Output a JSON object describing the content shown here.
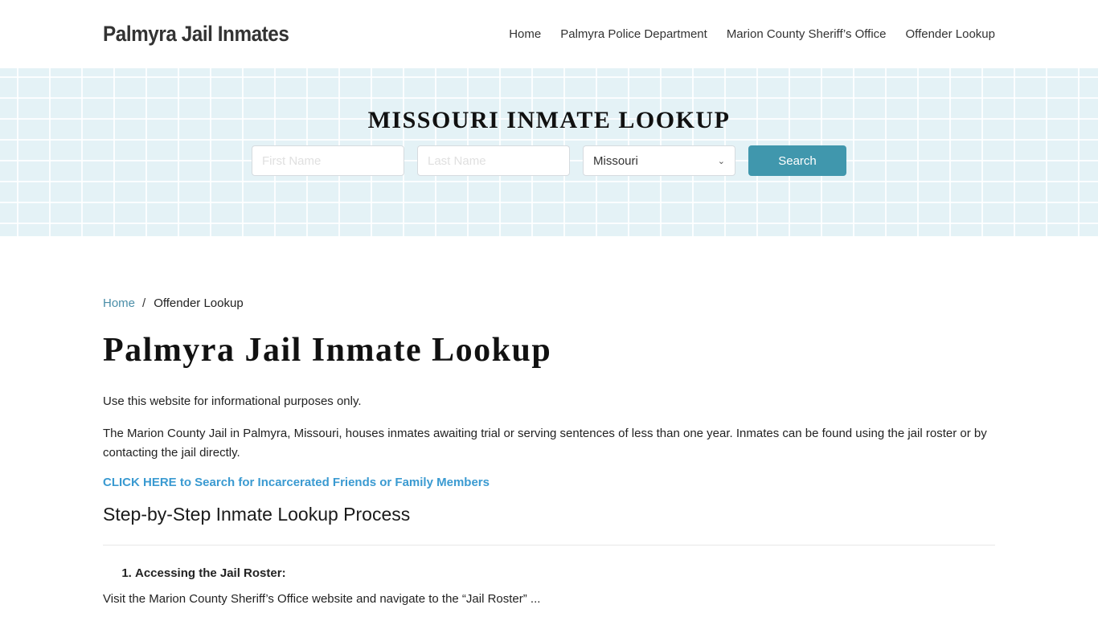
{
  "header": {
    "brand": "Palmyra Jail Inmates",
    "nav": [
      {
        "label": "Home"
      },
      {
        "label": "Palmyra Police Department"
      },
      {
        "label": "Marion County Sheriff’s Office"
      },
      {
        "label": "Offender Lookup"
      }
    ]
  },
  "hero": {
    "title": "MISSOURI INMATE LOOKUP",
    "first_name_placeholder": "First Name",
    "last_name_placeholder": "Last Name",
    "state_selected": "Missouri",
    "search_label": "Search",
    "accent_color": "#4097ad"
  },
  "breadcrumb": {
    "home": "Home",
    "separator": "/",
    "current": "Offender Lookup"
  },
  "main": {
    "title": "Palmyra Jail Inmate Lookup",
    "paragraph1": "Use this website for informational purposes only.",
    "paragraph2": "The Marion County Jail in Palmyra, Missouri, houses inmates awaiting trial or serving sentences of less than one year. Inmates can be found using the jail roster or by contacting the jail directly.",
    "cta_link": "CLICK HERE to Search for Incarcerated Friends or Family Members",
    "section_heading": "Step-by-Step Inmate Lookup Process",
    "steps": [
      {
        "label": "Accessing the Jail Roster:"
      }
    ],
    "step1_text": "Visit the Marion County Sheriff’s Office website and navigate to the “Jail Roster” ..."
  }
}
